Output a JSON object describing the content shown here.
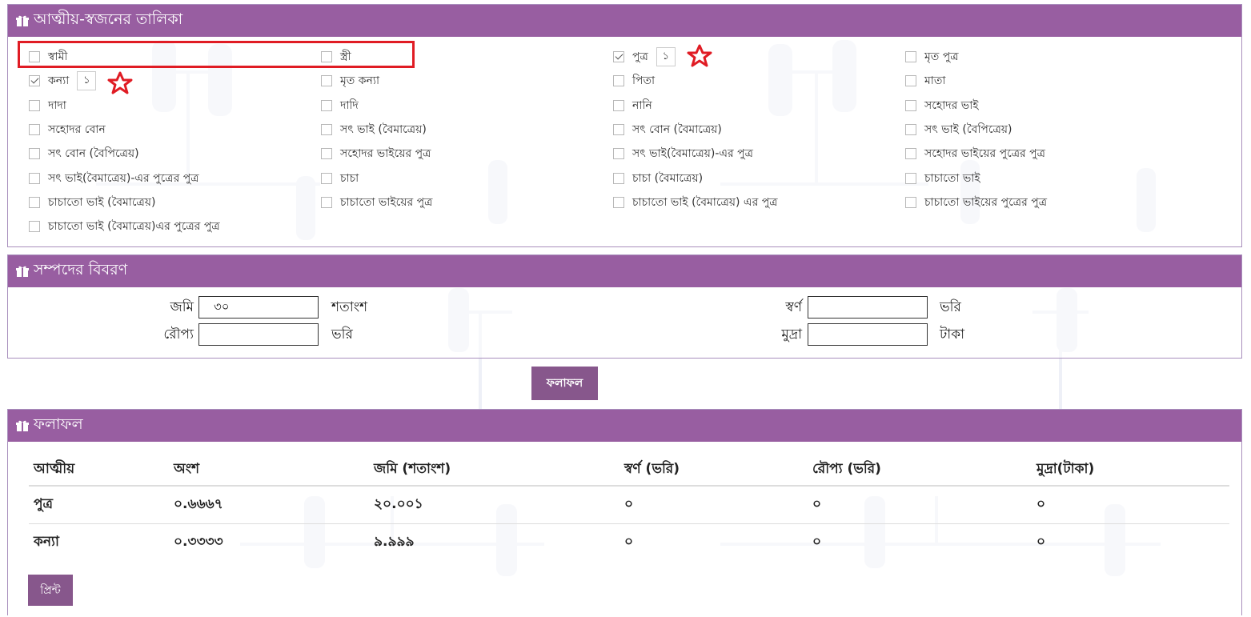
{
  "relatives_panel": {
    "title": "আত্মীয়-স্বজনের তালিকা",
    "items": [
      {
        "label": "স্বামী",
        "checked": false
      },
      {
        "label": "স্ত্রী",
        "checked": false
      },
      {
        "label": "পুত্র",
        "checked": true,
        "qty": "১"
      },
      {
        "label": "মৃত পুত্র",
        "checked": false
      },
      {
        "label": "কন্যা",
        "checked": true,
        "qty": "১"
      },
      {
        "label": "মৃত কন্যা",
        "checked": false
      },
      {
        "label": "পিতা",
        "checked": false
      },
      {
        "label": "মাতা",
        "checked": false
      },
      {
        "label": "দাদা",
        "checked": false
      },
      {
        "label": "দাদি",
        "checked": false
      },
      {
        "label": "নানি",
        "checked": false
      },
      {
        "label": "সহোদর ভাই",
        "checked": false
      },
      {
        "label": "সহোদর বোন",
        "checked": false
      },
      {
        "label": "সৎ ভাই (বৈমাত্রেয়)",
        "checked": false
      },
      {
        "label": "সৎ বোন (বৈমাত্রেয়)",
        "checked": false
      },
      {
        "label": "সৎ ভাই (বৈপিত্রেয়)",
        "checked": false
      },
      {
        "label": "সৎ বোন (বৈপিত্রেয়)",
        "checked": false
      },
      {
        "label": "সহোদর ভাইয়ের পুত্র",
        "checked": false
      },
      {
        "label": "সৎ ভাই(বৈমাত্রেয়)-এর পুত্র",
        "checked": false
      },
      {
        "label": "সহোদর ভাইয়ের পুত্রের পুত্র",
        "checked": false
      },
      {
        "label": "সৎ ভাই(বৈমাত্রেয়)-এর পুত্রের পুত্র",
        "checked": false
      },
      {
        "label": "চাচা",
        "checked": false
      },
      {
        "label": "চাচা (বৈমাত্রেয়)",
        "checked": false
      },
      {
        "label": "চাচাতো ভাই",
        "checked": false
      },
      {
        "label": "চাচাতো ভাই (বৈমাত্রেয়)",
        "checked": false
      },
      {
        "label": "চাচাতো ভাইয়ের পুত্র",
        "checked": false
      },
      {
        "label": "চাচাতো ভাই (বৈমাত্রেয়) এর পুত্র",
        "checked": false
      },
      {
        "label": "চাচাতো ভাইয়ের পুত্রের পুত্র",
        "checked": false
      },
      {
        "label": "চাচাতো ভাই (বৈমাত্রেয়)এর পুত্রের পুত্র",
        "checked": false
      }
    ]
  },
  "assets_panel": {
    "title": "সম্পদের বিবরণ",
    "land": {
      "label": "জমি",
      "value": "৩০",
      "unit": "শতাংশ"
    },
    "gold": {
      "label": "স্বর্ণ",
      "value": "",
      "unit": "ভরি"
    },
    "silver": {
      "label": "রৌপ্য",
      "value": "",
      "unit": "ভরি"
    },
    "money": {
      "label": "মুদ্রা",
      "value": "",
      "unit": "টাকা"
    }
  },
  "result_button_label": "ফলাফল",
  "results_panel": {
    "title": "ফলাফল",
    "columns": [
      "আত্মীয়",
      "অংশ",
      "জমি (শতাংশ)",
      "স্বর্ণ (ভরি)",
      "রৌপ্য (ভরি)",
      "মুদ্রা(টাকা)"
    ],
    "rows": [
      [
        "পুত্র",
        "০.৬৬৬৭",
        "২০.০০১",
        "০",
        "০",
        "০"
      ],
      [
        "কন্যা",
        "০.৩৩৩৩",
        "৯.৯৯৯",
        "০",
        "০",
        "০"
      ]
    ],
    "print_label": "প্রিন্ট"
  },
  "colors": {
    "header_bg": "#985ea1",
    "button_bg": "#87578c",
    "annotation_red": "#e01c24"
  }
}
